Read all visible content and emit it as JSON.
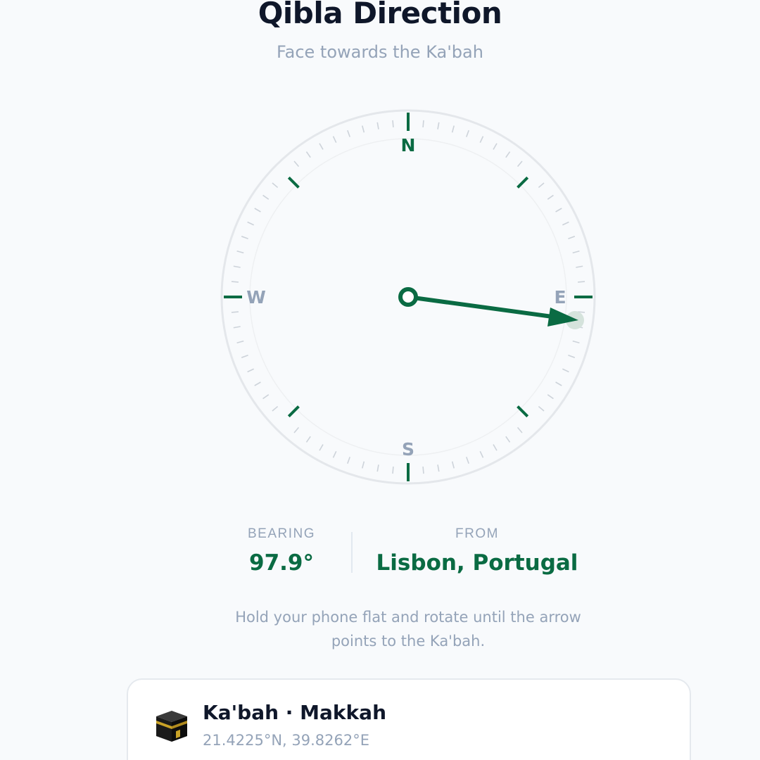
{
  "header": {
    "title": "Qibla Direction",
    "subtitle": "Face towards the Ka'bah"
  },
  "compass": {
    "cardinals": {
      "north": "N",
      "east": "E",
      "south": "S",
      "west": "W"
    },
    "bearing_degrees": 97.9,
    "accent_color": "#0a6b43",
    "icons": [
      "compass-ring",
      "qibla-arrow",
      "kaabah-target-dot"
    ]
  },
  "stats": {
    "bearing_label": "BEARING",
    "bearing_value": "97.9°",
    "from_label": "FROM",
    "from_value": "Lisbon, Portugal"
  },
  "hint": "Hold your phone flat and rotate until the arrow points to the Ka'bah.",
  "card": {
    "icon": "kaabah-icon",
    "title": "Ka'bah · Makkah",
    "coordinates": "21.4225°N, 39.8262°E"
  },
  "colors": {
    "accent": "#0a6b43",
    "muted": "#94a3b8",
    "text": "#0f172a",
    "background": "#f8fafc"
  }
}
